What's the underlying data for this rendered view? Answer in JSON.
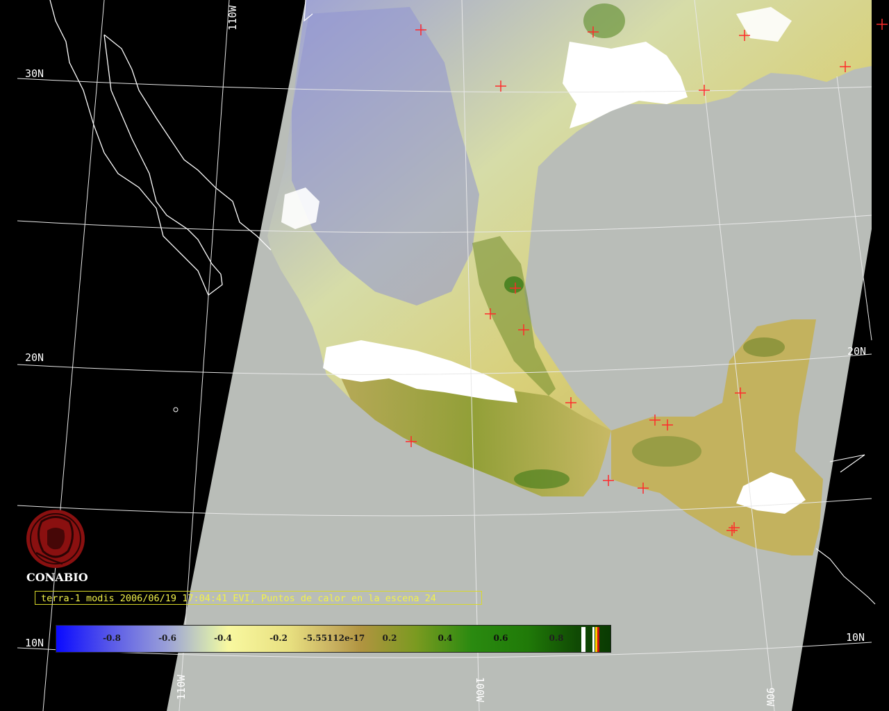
{
  "caption": "terra-1 modis 2006/06/19 17:04:41 EVI, Puntos de calor en la escena 24",
  "logo": {
    "text": "CONABIO",
    "color": "#8a1010",
    "icon": "conabio-logo-icon"
  },
  "graticule": {
    "lat_labels": [
      "30N",
      "20N",
      "10N"
    ],
    "lat_labels_right": [
      "20N",
      "10N"
    ],
    "lon_labels_top": [
      "110W"
    ],
    "lon_labels_bottom": [
      "110W",
      "100W",
      "90W"
    ]
  },
  "colorbar": {
    "ticks": [
      "-0.8",
      "-0.6",
      "-0.4",
      "-0.2",
      "-5.55112e-17",
      "0.2",
      "0.4",
      "0.6",
      "0.8"
    ],
    "tick_values": [
      -0.8,
      -0.6,
      -0.4,
      -0.2,
      -5.55112e-17,
      0.2,
      0.4,
      0.6,
      0.8
    ],
    "colors": {
      "low": "#0a0aff",
      "mid": "#f8f8a0",
      "high": "#0a3a02",
      "cloud": "#ffffff",
      "hotspot": "#ff2020"
    }
  },
  "map": {
    "water_color": "#b9bdb8",
    "outside_swath_color": "#000000",
    "coastline_color": "#ffffff",
    "hotspot_count": 24
  }
}
